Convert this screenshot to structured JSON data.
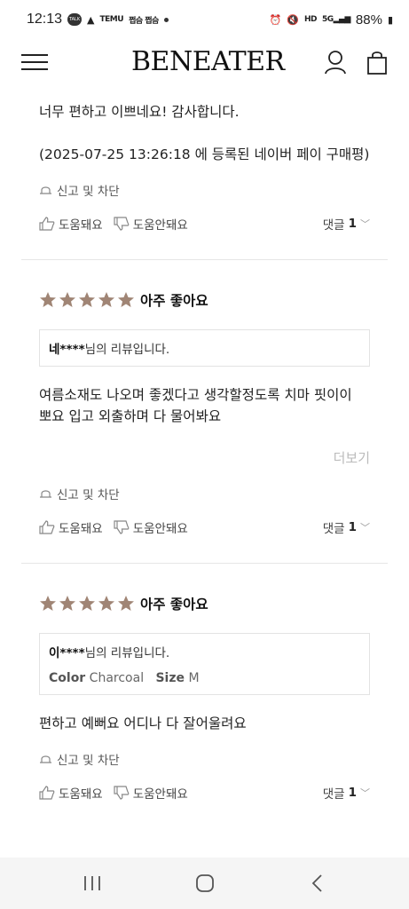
{
  "status": {
    "time": "12:13",
    "mini_apps": "쩝슴 쩝슴",
    "battery": "88%"
  },
  "header": {
    "logo": "BENEATER"
  },
  "reviews": [
    {
      "body_lines": [
        "너무 편하고 이쁘네요! 감사합니다."
      ],
      "source": "(2025-07-25 13:26:18 에 등록된 네이버 페이 구매평)",
      "report_label": "신고 및 차단",
      "helpful_label": "도움돼요",
      "unhelpful_label": "도움안돼요",
      "comments_label": "댓글",
      "comments_count": "1"
    },
    {
      "rating": 5,
      "rating_label": "아주 좋아요",
      "author_name": "네****",
      "author_suffix": "님의 리뷰입니다.",
      "body_lines": [
        "여름소재도 나오며 좋겠다고 생각할정도록 치마 핏이이",
        "뽀요 입고 외출하며 다 물어봐요"
      ],
      "more_label": "더보기",
      "report_label": "신고 및 차단",
      "helpful_label": "도움돼요",
      "unhelpful_label": "도움안돼요",
      "comments_label": "댓글",
      "comments_count": "1"
    },
    {
      "rating": 5,
      "rating_label": "아주 좋아요",
      "author_name": "이****",
      "author_suffix": "님의 리뷰입니다.",
      "option_color_label": "Color",
      "option_color_value": "Charcoal",
      "option_size_label": "Size",
      "option_size_value": "M",
      "body_lines": [
        "편하고 예뻐요 어디나 다 잘어울려요"
      ],
      "report_label": "신고 및 차단",
      "helpful_label": "도움돼요",
      "unhelpful_label": "도움안돼요",
      "comments_label": "댓글",
      "comments_count": "1"
    }
  ],
  "colors": {
    "star": "#a08575",
    "divider": "#e6e6e6"
  }
}
